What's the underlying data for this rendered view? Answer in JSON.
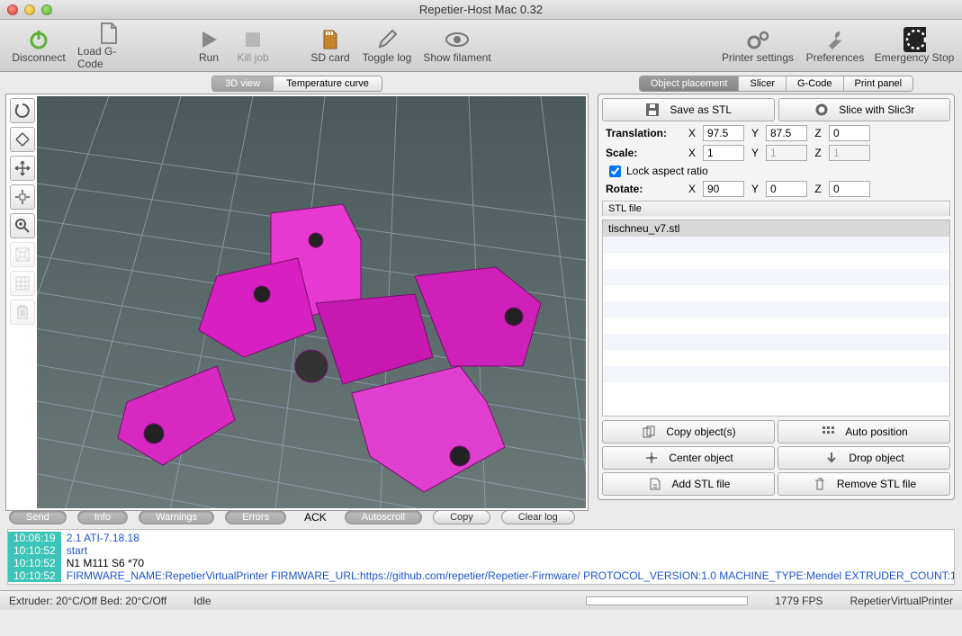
{
  "window": {
    "title": "Repetier-Host Mac 0.32"
  },
  "toolbar": {
    "disconnect": "Disconnect",
    "loadgcode": "Load G-Code",
    "run": "Run",
    "killjob": "Kill job",
    "sdcard": "SD card",
    "togglelog": "Toggle log",
    "showfilament": "Show filament",
    "printersettings": "Printer settings",
    "preferences": "Preferences",
    "emergency": "Emergency Stop"
  },
  "leftTabs": {
    "view3d": "3D view",
    "tempcurve": "Temperature curve"
  },
  "rightTabs": {
    "placement": "Object placement",
    "slicer": "Slicer",
    "gcode": "G-Code",
    "printpanel": "Print panel"
  },
  "panel": {
    "saveSTL": "Save as STL",
    "slice": "Slice with Slic3r",
    "translation": "Translation:",
    "scale": "Scale:",
    "rotate": "Rotate:",
    "lock": "Lock aspect ratio",
    "X": "X",
    "Y": "Y",
    "Z": "Z",
    "tx": "97.5",
    "ty": "87.5",
    "tz": "0",
    "sx": "1",
    "sy": "1",
    "sz": "1",
    "rx": "90",
    "ry": "0",
    "rz": "0",
    "stlHead": "STL file",
    "stlItems": [
      "tischneu_v7.stl"
    ],
    "copy": "Copy object(s)",
    "autopos": "Auto position",
    "center": "Center object",
    "drop": "Drop object",
    "addstl": "Add STL file",
    "removestl": "Remove STL file"
  },
  "consoleBar": {
    "send": "Send",
    "info": "Info",
    "warnings": "Warnings",
    "errors": "Errors",
    "ack": "ACK",
    "autoscroll": "Autoscroll",
    "copy": "Copy",
    "clear": "Clear log"
  },
  "console": [
    {
      "ts": "10:06:19",
      "msg": "2.1 ATI-7.18.18",
      "cls": "blue"
    },
    {
      "ts": "10:10:52",
      "msg": "start",
      "cls": "blue"
    },
    {
      "ts": "10:10:52",
      "msg": "N1 M111 S6 *70",
      "cls": ""
    },
    {
      "ts": "10:10:52",
      "msg": "FIRMWARE_NAME:RepetierVirtualPrinter FIRMWARE_URL:https://github.com/repetier/Repetier-Firmware/ PROTOCOL_VERSION:1.0 MACHINE_TYPE:Mendel EXTRUDER_COUNT:1",
      "cls": "blue"
    }
  ],
  "status": {
    "extruder": "Extruder: 20°C/Off Bed: 20°C/Off",
    "state": "Idle",
    "fps": "1779 FPS",
    "printer": "RepetierVirtualPrinter"
  }
}
